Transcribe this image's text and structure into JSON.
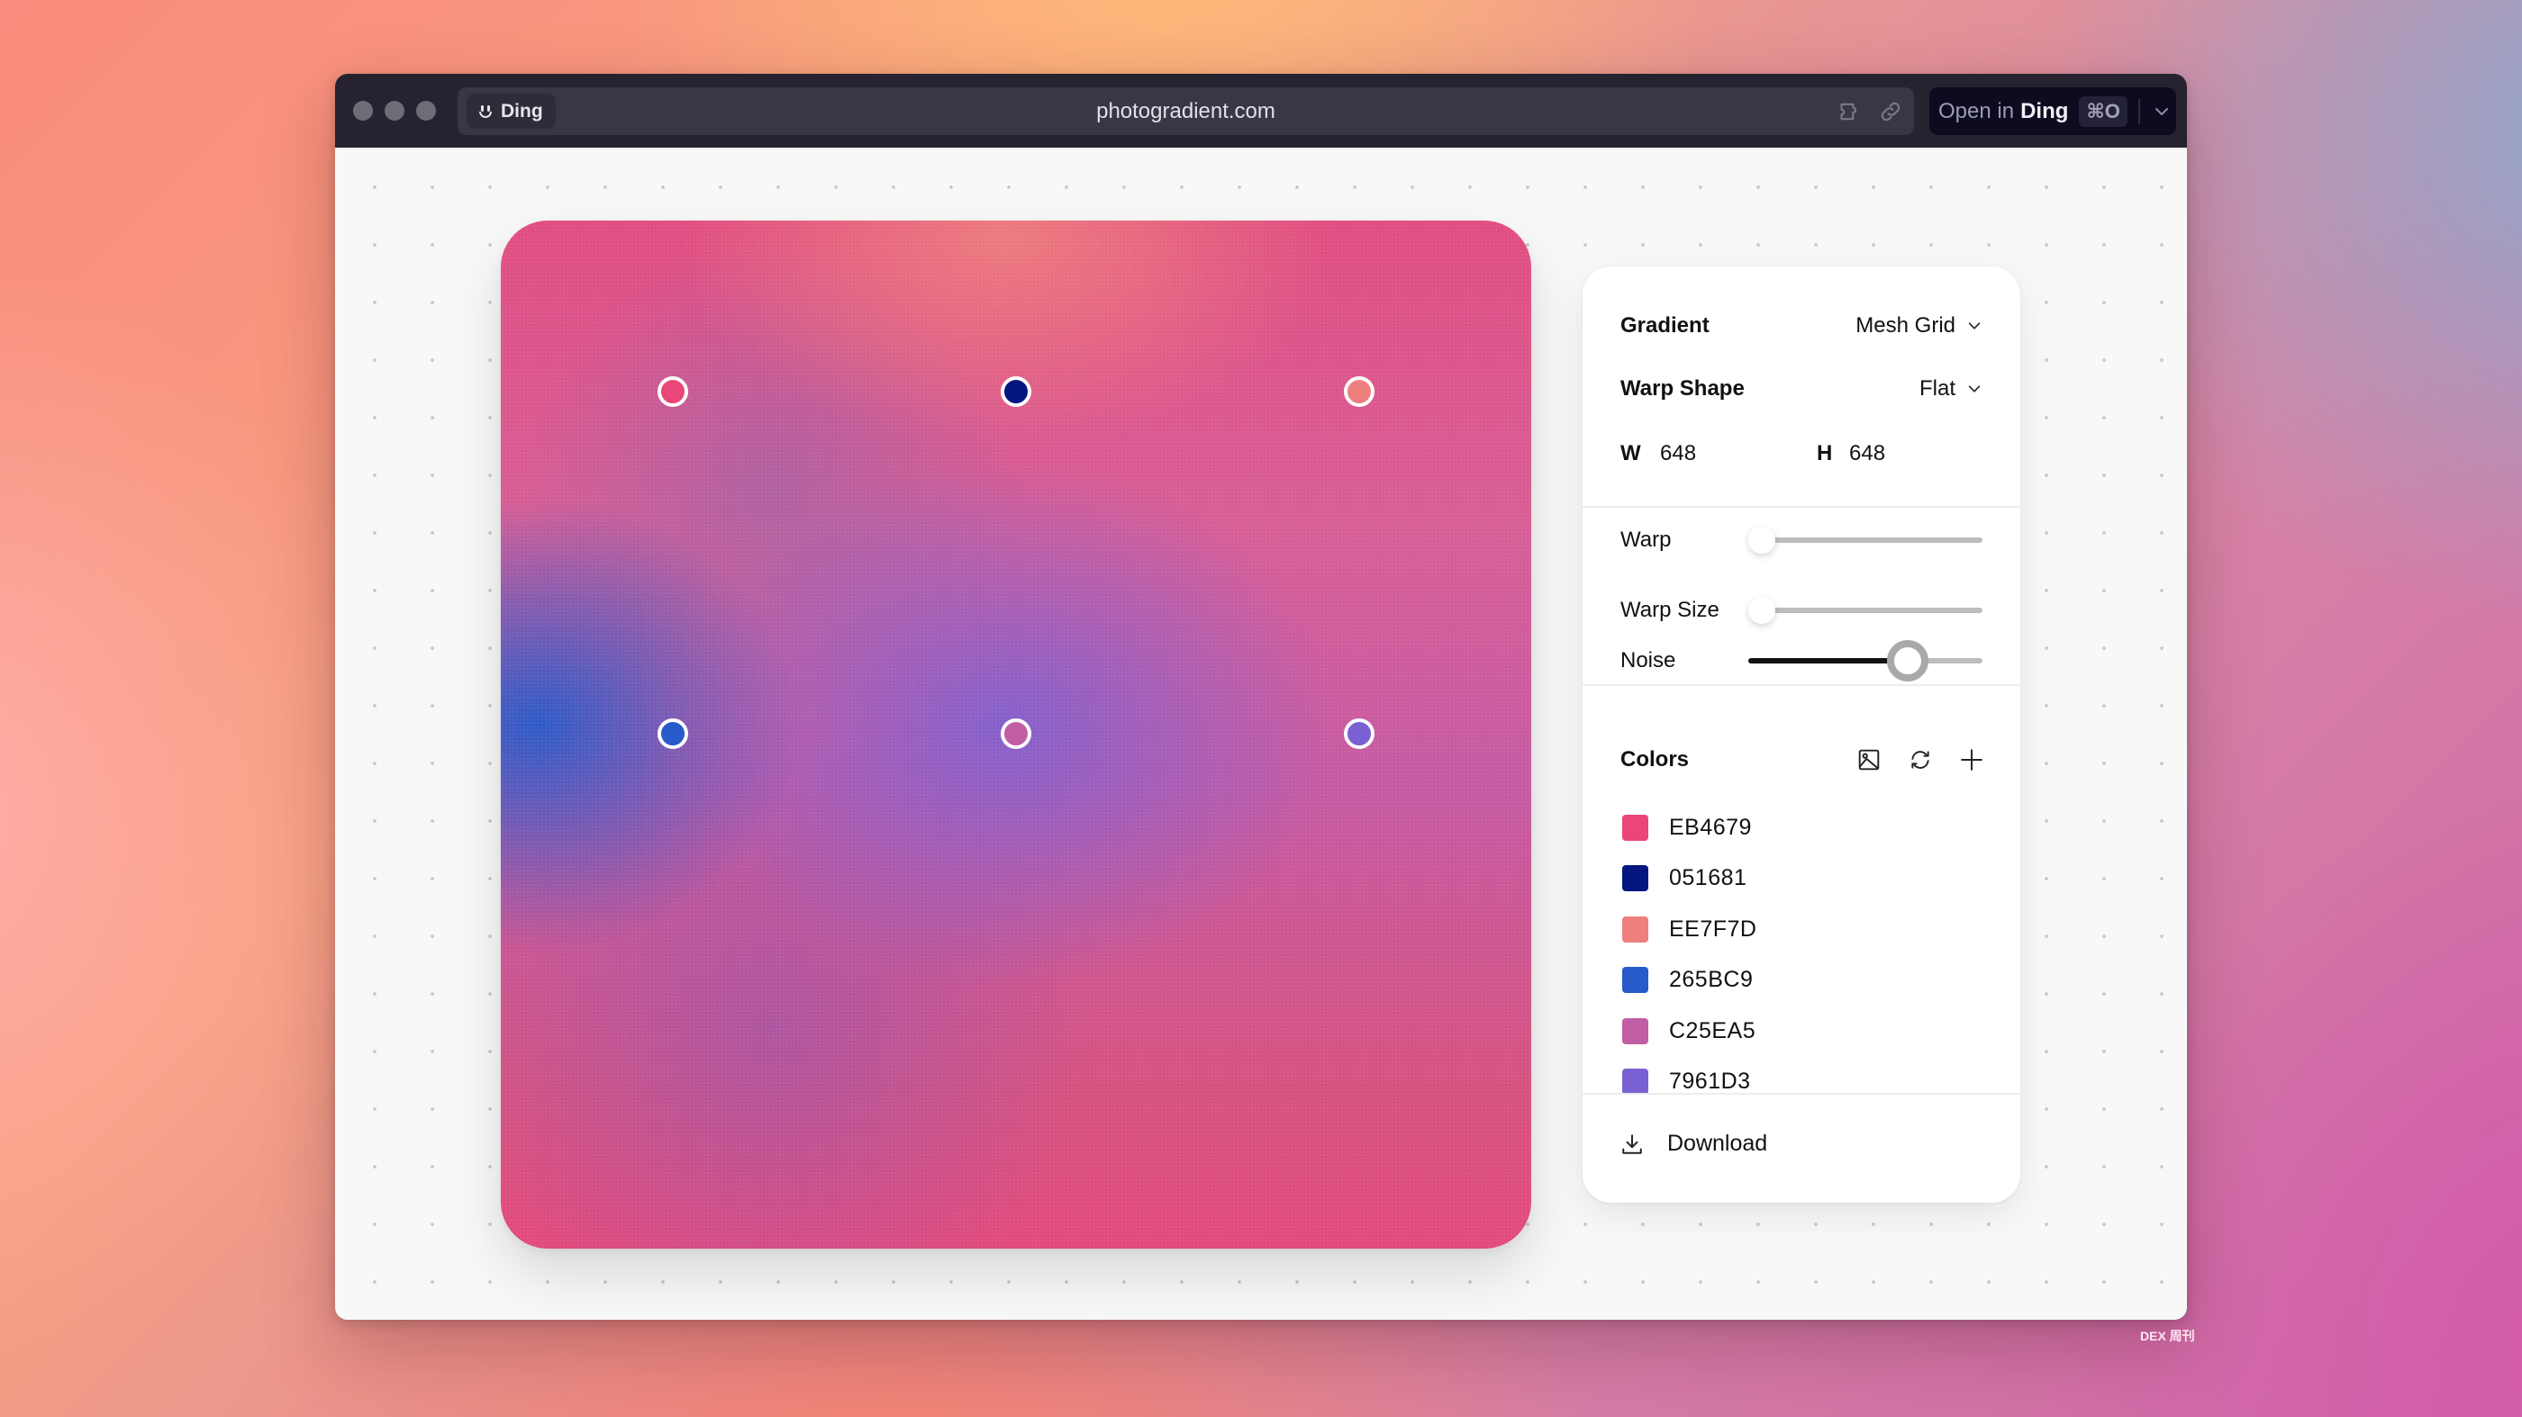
{
  "browser": {
    "app_pill_label": "Ding",
    "url": "photogradient.com",
    "open_button": {
      "prefix": "Open in",
      "app": "Ding",
      "shortcut": "⌘O"
    },
    "icons": [
      "extension-icon",
      "link-icon",
      "chevron-down-icon"
    ]
  },
  "canvas": {
    "type": "Mesh Grid",
    "control_points": [
      {
        "row": 1,
        "col": 1,
        "color": "#EB4679"
      },
      {
        "row": 1,
        "col": 2,
        "color": "#051681"
      },
      {
        "row": 1,
        "col": 3,
        "color": "#EE7F7D"
      },
      {
        "row": 2,
        "col": 1,
        "color": "#265BC9"
      },
      {
        "row": 2,
        "col": 2,
        "color": "#C25EA5"
      },
      {
        "row": 2,
        "col": 3,
        "color": "#7961D3"
      }
    ]
  },
  "panel": {
    "gradient": {
      "label": "Gradient",
      "value": "Mesh Grid"
    },
    "warp_shape": {
      "label": "Warp Shape",
      "value": "Flat"
    },
    "width": {
      "label": "W",
      "value": "648"
    },
    "height": {
      "label": "H",
      "value": "648"
    },
    "sliders": [
      {
        "label": "Warp",
        "value": 0
      },
      {
        "label": "Warp Size",
        "value": 0
      },
      {
        "label": "Noise",
        "value": 0.68
      }
    ],
    "colors": {
      "label": "Colors",
      "actions": [
        "image-icon",
        "refresh-icon",
        "plus-icon"
      ],
      "items": [
        {
          "hex": "EB4679",
          "color": "#EB4679"
        },
        {
          "hex": "051681",
          "color": "#051681"
        },
        {
          "hex": "EE7F7D",
          "color": "#EE7F7D"
        },
        {
          "hex": "265BC9",
          "color": "#265BC9"
        },
        {
          "hex": "C25EA5",
          "color": "#C25EA5"
        },
        {
          "hex": "7961D3",
          "color": "#7961D3"
        }
      ]
    },
    "download_label": "Download"
  },
  "watermark": "DEX 周刊"
}
